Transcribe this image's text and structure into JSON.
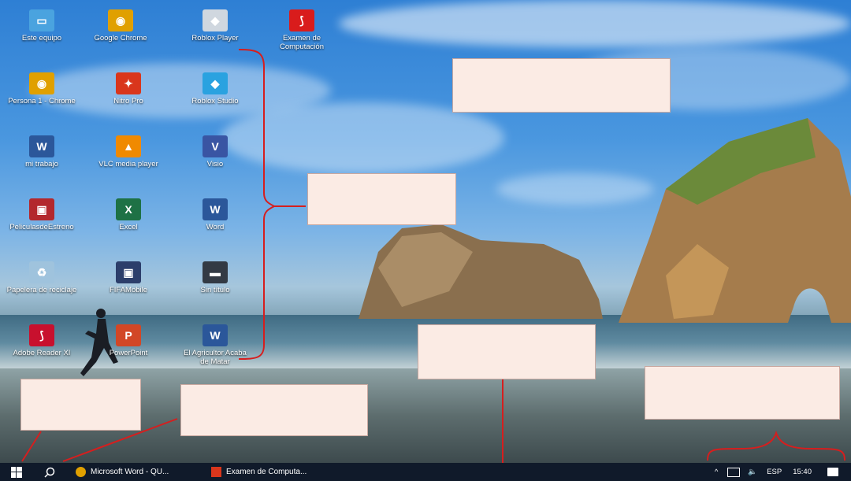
{
  "desktop": {
    "icons": [
      {
        "label": "Este equipo",
        "icon": "computer-icon",
        "color": "#4aa3df",
        "glyph": "▭"
      },
      {
        "label": "Google Chrome",
        "icon": "chrome-icon",
        "color": "#e0a000",
        "glyph": "◉"
      },
      {
        "label": "Roblox Player",
        "icon": "roblox-icon",
        "color": "#d0d7df",
        "glyph": "◆"
      },
      {
        "label": "Examen de Computación",
        "icon": "pdf-icon",
        "color": "#d91c1c",
        "glyph": "⟆"
      },
      {
        "label": "Persona 1 - Chrome",
        "icon": "chrome-profile-icon",
        "color": "#e0a000",
        "glyph": "◉"
      },
      {
        "label": "Nitro Pro",
        "icon": "nitro-icon",
        "color": "#d9361c",
        "glyph": "✦"
      },
      {
        "label": "Roblox Studio",
        "icon": "roblox-studio-icon",
        "color": "#2aa2e0",
        "glyph": "◆"
      },
      {
        "label": "mi trabajo",
        "icon": "word-doc-icon",
        "color": "#2b579a",
        "glyph": "W"
      },
      {
        "label": "VLC media player",
        "icon": "vlc-icon",
        "color": "#f08a00",
        "glyph": "▲"
      },
      {
        "label": "Visio",
        "icon": "visio-icon",
        "color": "#3955a3",
        "glyph": "V"
      },
      {
        "label": "PeliculasdeEstreno",
        "icon": "movies-icon",
        "color": "#b3282d",
        "glyph": "▣"
      },
      {
        "label": "Excel",
        "icon": "excel-icon",
        "color": "#1e7145",
        "glyph": "X"
      },
      {
        "label": "Word",
        "icon": "word-icon",
        "color": "#2b579a",
        "glyph": "W"
      },
      {
        "label": "Papelera de reciclaje",
        "icon": "recycle-bin-icon",
        "color": "#9fc3dd",
        "glyph": "♻"
      },
      {
        "label": "FIFAMobile",
        "icon": "fifa-icon",
        "color": "#2c3e6b",
        "glyph": "▣"
      },
      {
        "label": "Sin título",
        "icon": "screenshot-icon",
        "color": "#333a44",
        "glyph": "▬"
      },
      {
        "label": "Adobe Reader XI",
        "icon": "adobe-reader-icon",
        "color": "#c8102e",
        "glyph": "⟆"
      },
      {
        "label": "PowerPoint",
        "icon": "powerpoint-icon",
        "color": "#d24726",
        "glyph": "P"
      },
      {
        "label": "El Agricultor Acaba de Matar",
        "icon": "word-doc-icon",
        "color": "#2b579a",
        "glyph": "W"
      }
    ]
  },
  "taskbar": {
    "start": "start-icon",
    "search": "search-icon",
    "apps": [
      {
        "label": "Microsoft Word - QU...",
        "icon": "chrome-icon",
        "color": "#e0a000"
      },
      {
        "label": "Examen de Computa...",
        "icon": "pdf-icon",
        "color": "#d9361c"
      }
    ],
    "tray": {
      "chevron": "^",
      "language": "ESP",
      "time": "15:40"
    }
  }
}
